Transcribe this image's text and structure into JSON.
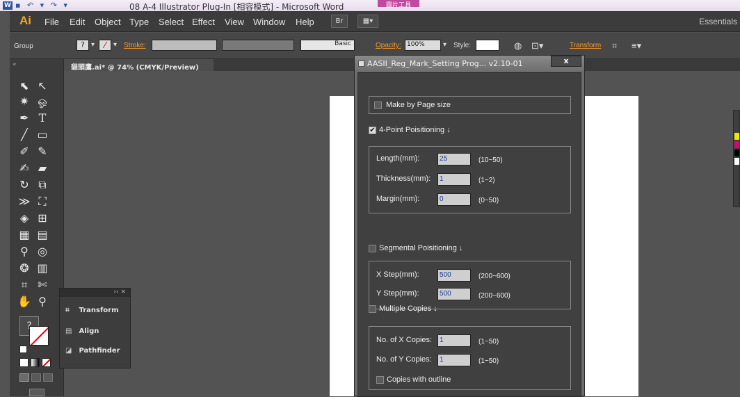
{
  "word_window": {
    "app_icon": "W",
    "title": "08 A-4 Illustrator Plug-In [相容模式] - Microsoft Word",
    "picture_tab": "圖片工具"
  },
  "menubar": {
    "logo": "Ai",
    "items": [
      "File",
      "Edit",
      "Object",
      "Type",
      "Select",
      "Effect",
      "View",
      "Window",
      "Help"
    ],
    "bridge_label": "Br",
    "workspace": "Essentials"
  },
  "control_bar": {
    "selection": "Group",
    "stroke_label": "Stroke:",
    "brush": "Basic",
    "opacity_label": "Opacity:",
    "opacity_value": "100%",
    "style_label": "Style:",
    "transform_label": "Transform"
  },
  "document_tab": {
    "label": "貓頭鷹.ai* @ 74% (CMYK/Preview)",
    "close": "×"
  },
  "float_panel": {
    "items": [
      "Transform",
      "Align",
      "Pathfinder"
    ]
  },
  "dialog": {
    "title": "AASII_Reg_Mark_Setting Prog... v2.10-01",
    "close": "x",
    "make_by_page_size": {
      "label": "Make by Page size",
      "checked": false
    },
    "four_point": {
      "label": "4-Point Poisitioning ↓",
      "checked": true,
      "fields": [
        {
          "label": "Length(mm):",
          "value": "25",
          "range": "(10~50)"
        },
        {
          "label": "Thickness(mm):",
          "value": "1",
          "range": "(1~2)"
        },
        {
          "label": "Margin(mm):",
          "value": "0",
          "range": "(0~50)"
        }
      ]
    },
    "segmental": {
      "label": "Segmental Poisitioning ↓",
      "checked": false,
      "fields": [
        {
          "label": "X Step(mm):",
          "value": "500",
          "range": "(200~600)"
        },
        {
          "label": "Y Step(mm):",
          "value": "500",
          "range": "(200~600)"
        }
      ]
    },
    "multiple_copies": {
      "label": "Multiple Copies ↓",
      "checked": false,
      "fields": [
        {
          "label": "No. of X Copies:",
          "value": "1",
          "range": "(1~50)"
        },
        {
          "label": "No. of Y Copies:",
          "value": "1",
          "range": "(1~50)"
        }
      ],
      "outline": {
        "label": "Copies with outline",
        "checked": false
      }
    }
  }
}
